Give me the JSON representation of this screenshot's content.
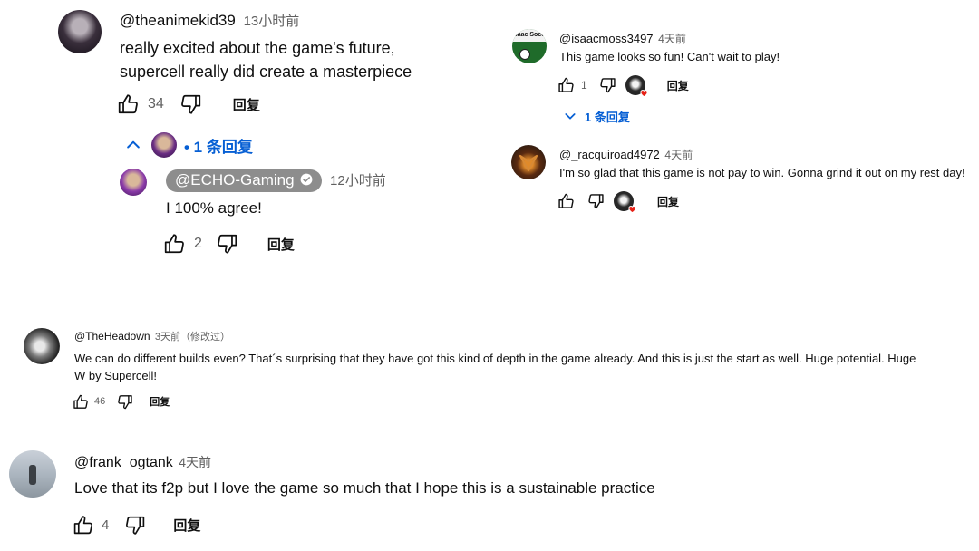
{
  "c1": {
    "author": "@theanimekid39",
    "time": "13小时前",
    "lines": [
      "really excited about the game's future,",
      "supercell really did create a masterpiece"
    ],
    "likes": "34",
    "reply_label": "回复",
    "replies_toggle": "• 1 条回复",
    "reply": {
      "author": "@ECHO-Gaming",
      "time": "12小时前",
      "text": "I 100% agree!",
      "likes": "2",
      "reply_label": "回复"
    }
  },
  "c2": {
    "avatar_text": "saac Socc",
    "author": "@isaacmoss3497",
    "time": "4天前",
    "text": "This game looks so fun! Can't wait to play!",
    "likes": "1",
    "reply_label": "回复",
    "replies_toggle": "1 条回复"
  },
  "c3": {
    "author": "@_racquiroad4972",
    "time": "4天前",
    "text": "I'm so glad that this game is not pay to win. Gonna grind it out on my rest day!",
    "reply_label": "回复"
  },
  "c4": {
    "author": "@TheHeadown",
    "time": "3天前（修改过）",
    "lines": [
      "We can do different builds even? That´s surprising that they have got this kind of depth in the game already. And this is just the start as well. Huge potential. Huge",
      "W by Supercell!"
    ],
    "likes": "46",
    "reply_label": "回复"
  },
  "c5": {
    "author": "@frank_ogtank",
    "time": "4天前",
    "text": "Love that its f2p but I love the game so much that I hope this is a sustainable practice",
    "likes": "4",
    "reply_label": "回复"
  },
  "colors": {
    "link": "#065fd4",
    "muted": "#606060",
    "pill": "#8d8d8d",
    "heart": "#e62117"
  },
  "icons": [
    "thumbs-up-icon",
    "thumbs-down-icon",
    "chevron-up-icon",
    "chevron-down-icon",
    "verified-check-icon",
    "heart-icon"
  ]
}
